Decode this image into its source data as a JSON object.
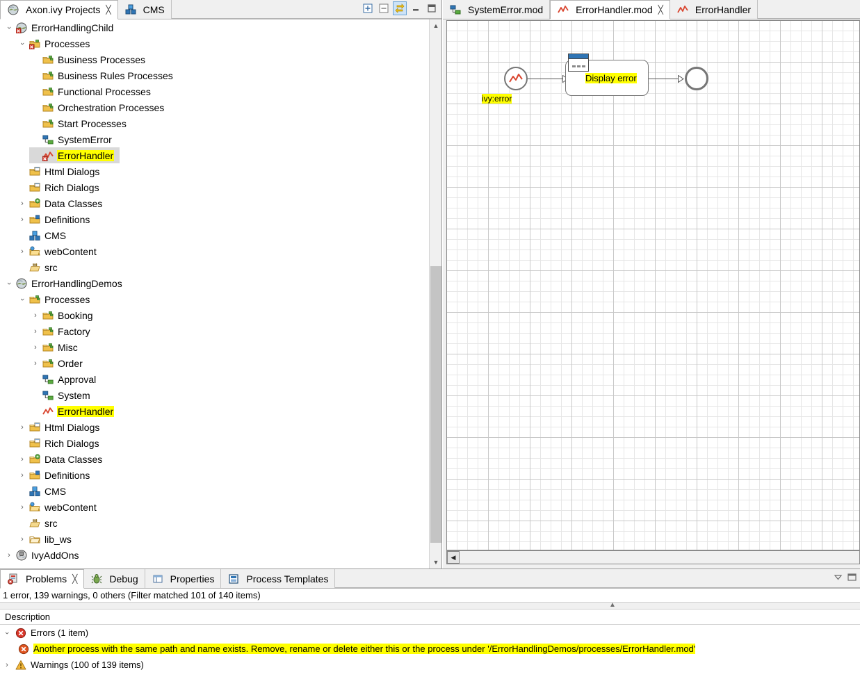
{
  "explorer": {
    "tabs": [
      {
        "label": "Axon.ivy Projects",
        "icon": "ivy-projects-icon",
        "active": true,
        "closable": true
      },
      {
        "label": "CMS",
        "icon": "cms-icon",
        "active": false,
        "closable": false
      }
    ],
    "toolbar": [
      {
        "name": "expand-all-icon",
        "label": "Expand All",
        "toggled": false
      },
      {
        "name": "collapse-all-icon",
        "label": "Collapse All",
        "toggled": false
      },
      {
        "name": "link-with-editor-icon",
        "label": "Link with Editor",
        "toggled": true
      },
      {
        "name": "minimize-icon",
        "label": "Minimize",
        "toggled": false
      },
      {
        "name": "maximize-icon",
        "label": "Maximize",
        "toggled": false
      }
    ],
    "tree": [
      {
        "label": "ErrorHandlingChild",
        "indent": 0,
        "twisty": "expanded",
        "icon": "ivy-project-error-icon",
        "highlight": false,
        "selected": false
      },
      {
        "label": "Processes",
        "indent": 1,
        "twisty": "expanded",
        "icon": "process-folder-error-icon",
        "highlight": false,
        "selected": false
      },
      {
        "label": "Business Processes",
        "indent": 2,
        "twisty": "none",
        "icon": "process-folder-icon",
        "highlight": false,
        "selected": false
      },
      {
        "label": "Business Rules Processes",
        "indent": 2,
        "twisty": "none",
        "icon": "process-folder-icon",
        "highlight": false,
        "selected": false
      },
      {
        "label": "Functional Processes",
        "indent": 2,
        "twisty": "none",
        "icon": "process-folder-icon",
        "highlight": false,
        "selected": false
      },
      {
        "label": "Orchestration Processes",
        "indent": 2,
        "twisty": "none",
        "icon": "process-folder-icon",
        "highlight": false,
        "selected": false
      },
      {
        "label": "Start Processes",
        "indent": 2,
        "twisty": "none",
        "icon": "process-folder-icon",
        "highlight": false,
        "selected": false
      },
      {
        "label": "SystemError",
        "indent": 2,
        "twisty": "none",
        "icon": "process-icon",
        "highlight": false,
        "selected": false
      },
      {
        "label": "ErrorHandler",
        "indent": 2,
        "twisty": "none",
        "icon": "error-process-icon",
        "highlight": true,
        "selected": true
      },
      {
        "label": "Html Dialogs",
        "indent": 1,
        "twisty": "none",
        "icon": "dialog-folder-icon",
        "highlight": false,
        "selected": false
      },
      {
        "label": "Rich Dialogs",
        "indent": 1,
        "twisty": "none",
        "icon": "dialog-folder-icon",
        "highlight": false,
        "selected": false
      },
      {
        "label": "Data Classes",
        "indent": 1,
        "twisty": "collapsed",
        "icon": "data-class-folder-icon",
        "highlight": false,
        "selected": false
      },
      {
        "label": "Definitions",
        "indent": 1,
        "twisty": "collapsed",
        "icon": "definitions-folder-icon",
        "highlight": false,
        "selected": false
      },
      {
        "label": "CMS",
        "indent": 1,
        "twisty": "none",
        "icon": "cms-icon",
        "highlight": false,
        "selected": false
      },
      {
        "label": "webContent",
        "indent": 1,
        "twisty": "collapsed",
        "icon": "web-folder-icon",
        "highlight": false,
        "selected": false
      },
      {
        "label": "src",
        "indent": 1,
        "twisty": "none",
        "icon": "source-folder-icon",
        "highlight": false,
        "selected": false
      },
      {
        "label": "ErrorHandlingDemos",
        "indent": 0,
        "twisty": "expanded",
        "icon": "ivy-project-icon",
        "highlight": false,
        "selected": false
      },
      {
        "label": "Processes",
        "indent": 1,
        "twisty": "expanded",
        "icon": "process-folder-icon",
        "highlight": false,
        "selected": false
      },
      {
        "label": "Booking",
        "indent": 2,
        "twisty": "collapsed",
        "icon": "process-folder-icon",
        "highlight": false,
        "selected": false
      },
      {
        "label": "Factory",
        "indent": 2,
        "twisty": "collapsed",
        "icon": "process-folder-icon",
        "highlight": false,
        "selected": false
      },
      {
        "label": "Misc",
        "indent": 2,
        "twisty": "collapsed",
        "icon": "process-folder-icon",
        "highlight": false,
        "selected": false
      },
      {
        "label": "Order",
        "indent": 2,
        "twisty": "collapsed",
        "icon": "process-folder-icon",
        "highlight": false,
        "selected": false
      },
      {
        "label": "Approval",
        "indent": 2,
        "twisty": "none",
        "icon": "process-icon",
        "highlight": false,
        "selected": false
      },
      {
        "label": "System",
        "indent": 2,
        "twisty": "none",
        "icon": "process-icon",
        "highlight": false,
        "selected": false
      },
      {
        "label": "ErrorHandler",
        "indent": 2,
        "twisty": "none",
        "icon": "error-handler-process-icon",
        "highlight": true,
        "selected": false
      },
      {
        "label": "Html Dialogs",
        "indent": 1,
        "twisty": "collapsed",
        "icon": "dialog-folder-icon",
        "highlight": false,
        "selected": false
      },
      {
        "label": "Rich Dialogs",
        "indent": 1,
        "twisty": "none",
        "icon": "dialog-folder-icon",
        "highlight": false,
        "selected": false
      },
      {
        "label": "Data Classes",
        "indent": 1,
        "twisty": "collapsed",
        "icon": "data-class-folder-icon",
        "highlight": false,
        "selected": false
      },
      {
        "label": "Definitions",
        "indent": 1,
        "twisty": "collapsed",
        "icon": "definitions-folder-icon",
        "highlight": false,
        "selected": false
      },
      {
        "label": "CMS",
        "indent": 1,
        "twisty": "none",
        "icon": "cms-icon",
        "highlight": false,
        "selected": false
      },
      {
        "label": "webContent",
        "indent": 1,
        "twisty": "collapsed",
        "icon": "web-folder-icon",
        "highlight": false,
        "selected": false
      },
      {
        "label": "src",
        "indent": 1,
        "twisty": "none",
        "icon": "source-folder-icon",
        "highlight": false,
        "selected": false
      },
      {
        "label": "lib_ws",
        "indent": 1,
        "twisty": "collapsed",
        "icon": "lib-folder-icon",
        "highlight": false,
        "selected": false
      },
      {
        "label": "IvyAddOns",
        "indent": 0,
        "twisty": "collapsed",
        "icon": "ivy-addons-icon",
        "highlight": false,
        "selected": false
      }
    ]
  },
  "editor": {
    "tabs": [
      {
        "label": "SystemError.mod",
        "icon": "process-icon",
        "active": false,
        "closable": false
      },
      {
        "label": "ErrorHandler.mod",
        "icon": "error-handler-process-icon",
        "active": true,
        "closable": true
      },
      {
        "label": "ErrorHandler",
        "icon": "error-handler-process-icon",
        "active": false,
        "closable": false
      }
    ],
    "diagram": {
      "start_event_label": "ivy:error",
      "task_label": "Display error",
      "start_event_icon": "error-start-event-icon",
      "task_icon": "user-dialog-task-icon",
      "end_event_icon": "end-event-icon"
    }
  },
  "bottom": {
    "tabs": [
      {
        "label": "Problems",
        "icon": "problems-icon",
        "active": true,
        "closable": true
      },
      {
        "label": "Debug",
        "icon": "debug-icon",
        "active": false,
        "closable": false
      },
      {
        "label": "Properties",
        "icon": "properties-icon",
        "active": false,
        "closable": false
      },
      {
        "label": "Process Templates",
        "icon": "process-templates-icon",
        "active": false,
        "closable": false
      }
    ],
    "toolbar": [
      {
        "name": "view-menu-icon",
        "label": "View Menu"
      },
      {
        "name": "minimize-icon",
        "label": "Minimize"
      }
    ],
    "status": "1 error, 139 warnings, 0 others (Filter matched 101 of 140 items)",
    "column_header": "Description",
    "rows": [
      {
        "label": "Errors (1 item)",
        "twisty": "expanded",
        "icon": "error-icon",
        "child": false,
        "highlight": false
      },
      {
        "label": "Another process with the same path and name exists. Remove, rename or delete either this or the process under '/ErrorHandlingDemos/processes/ErrorHandler.mod'",
        "twisty": "none",
        "icon": "error-icon",
        "child": true,
        "highlight": true
      },
      {
        "label": "Warnings (100 of 139 items)",
        "twisty": "collapsed",
        "icon": "warning-icon",
        "child": false,
        "highlight": false
      }
    ]
  },
  "colors": {
    "highlight": "#ffff00",
    "selection": "#d9d9d9",
    "error": "#d32f2f",
    "warning": "#e8a33d",
    "accent": "#2f75b5",
    "folder": "#e8b84b"
  }
}
